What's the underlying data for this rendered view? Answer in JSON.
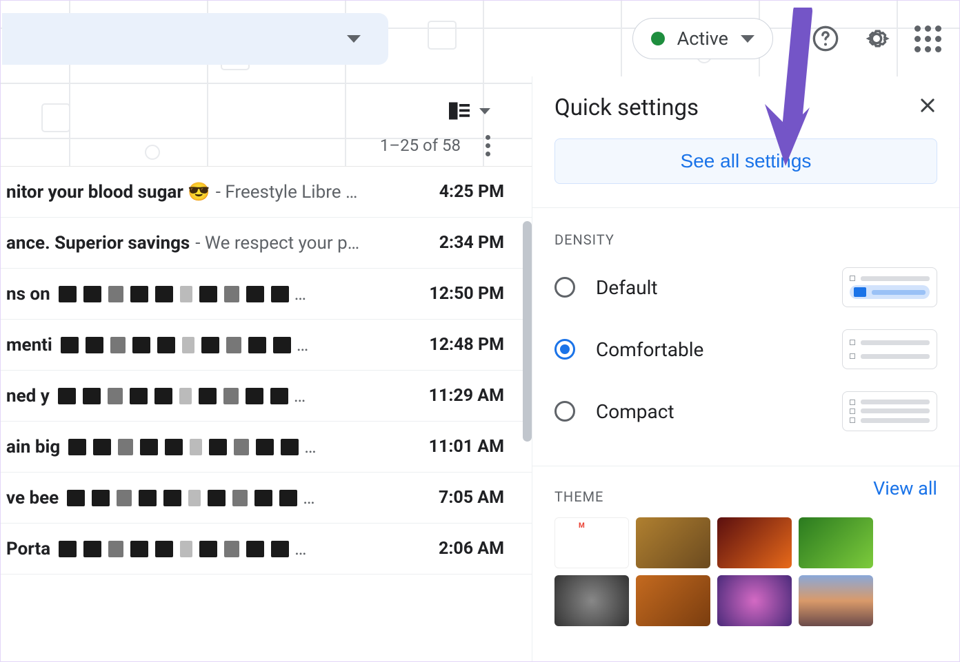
{
  "header": {
    "status_label": "Active",
    "status_color": "#1e8e3e"
  },
  "mail": {
    "pagination": "1–25 of 58",
    "rows": [
      {
        "subject_bold": "nitor your blood sugar 😎",
        "preview": " - Freestyle Libre …",
        "time": "4:25 PM",
        "redacted": false
      },
      {
        "subject_bold": "ance. Superior savings",
        "preview": " - We respect your p…",
        "time": "2:34 PM",
        "redacted": false
      },
      {
        "subject_bold": "ns on ",
        "preview": "…",
        "time": "12:50 PM",
        "redacted": true
      },
      {
        "subject_bold": " menti",
        "preview": "…",
        "time": "12:48 PM",
        "redacted": true
      },
      {
        "subject_bold": "ned y",
        "preview": "…",
        "time": "11:29 AM",
        "redacted": true
      },
      {
        "subject_bold": "ain big",
        "preview": "…",
        "time": "11:01 AM",
        "redacted": true
      },
      {
        "subject_bold": "ve bee",
        "preview": "…",
        "time": "7:05 AM",
        "redacted": true
      },
      {
        "subject_bold": " Porta",
        "preview": "…",
        "time": "2:06 AM",
        "redacted": true
      }
    ]
  },
  "panel": {
    "title": "Quick settings",
    "see_all": "See all settings",
    "density_title": "DENSITY",
    "density": [
      {
        "label": "Default",
        "selected": false
      },
      {
        "label": "Comfortable",
        "selected": true
      },
      {
        "label": "Compact",
        "selected": false
      }
    ],
    "theme_title": "THEME",
    "view_all": "View all"
  },
  "colors": {
    "link_blue": "#1a73e8",
    "pointer": "#7455c7"
  }
}
